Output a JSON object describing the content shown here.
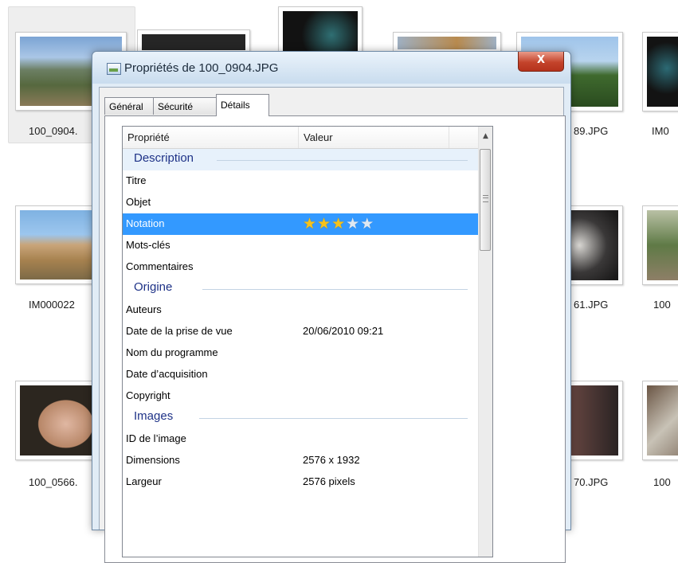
{
  "explorer": {
    "files": [
      {
        "name": "100_0904."
      },
      {
        "name": "89.JPG"
      },
      {
        "name": "IM0"
      },
      {
        "name": "IM000022"
      },
      {
        "name": "61.JPG"
      },
      {
        "name": "100"
      },
      {
        "name": "100_0566."
      },
      {
        "name": "70.JPG"
      },
      {
        "name": "100"
      }
    ]
  },
  "dialog": {
    "title": "Propriétés de 100_0904.JPG",
    "close_label": "X",
    "tabs": [
      {
        "label": "Général"
      },
      {
        "label": "Sécurité"
      },
      {
        "label": "Détails"
      }
    ],
    "columns": {
      "property": "Propriété",
      "value": "Valeur"
    },
    "rows": [
      {
        "type": "group",
        "label": "Description"
      },
      {
        "type": "prop",
        "name": "Titre",
        "value": ""
      },
      {
        "type": "prop",
        "name": "Objet",
        "value": ""
      },
      {
        "type": "prop",
        "name": "Notation",
        "rating": 3,
        "rating_max": 5,
        "selected": true
      },
      {
        "type": "prop",
        "name": "Mots-clés",
        "value": ""
      },
      {
        "type": "prop",
        "name": "Commentaires",
        "value": ""
      },
      {
        "type": "group",
        "label": "Origine"
      },
      {
        "type": "prop",
        "name": "Auteurs",
        "value": ""
      },
      {
        "type": "prop",
        "name": "Date de la prise de vue",
        "value": "20/06/2010 09:21"
      },
      {
        "type": "prop",
        "name": "Nom du programme",
        "value": ""
      },
      {
        "type": "prop",
        "name": "Date d’acquisition",
        "value": ""
      },
      {
        "type": "prop",
        "name": "Copyright",
        "value": ""
      },
      {
        "type": "group",
        "label": "Images"
      },
      {
        "type": "prop",
        "name": "ID de l’image",
        "value": ""
      },
      {
        "type": "prop",
        "name": "Dimensions",
        "value": "2576 x 1932"
      },
      {
        "type": "prop",
        "name": "Largeur",
        "value": "2576 pixels"
      }
    ]
  },
  "colors": {
    "selection": "#3399ff",
    "group_text": "#1e3287",
    "star_filled": "#f6c21a",
    "close_button": "#c4442c"
  }
}
